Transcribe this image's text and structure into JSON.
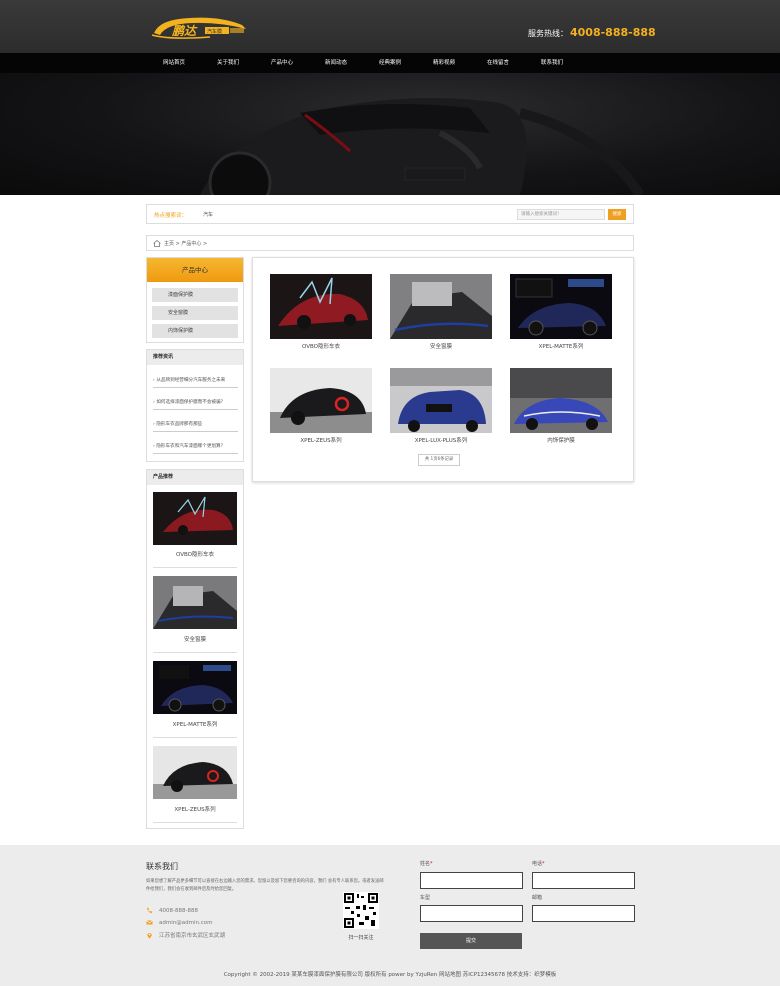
{
  "header": {
    "logo_text": "鹏达",
    "logo_sub": "汽车膜",
    "hotline_label": "服务热线：",
    "hotline_number": "4008-888-888"
  },
  "nav": [
    "网站首页",
    "关于我们",
    "产品中心",
    "新闻动态",
    "经典案例",
    "精彩视频",
    "在线留言",
    "联系我们"
  ],
  "hot": {
    "label": "热点搜索词：",
    "word": "汽车",
    "search_placeholder": "请输入搜索关键词！",
    "search_button": "搜索"
  },
  "breadcrumb": "主页 > 产品中心 >",
  "sidebar": {
    "category_title": "产品中心",
    "categories": [
      "漆面保护膜",
      "安全窗膜",
      "内饰保护膜"
    ],
    "news_title": "推荐资讯",
    "news": [
      "从品牌到经营细分汽车服务之未来",
      "如何选择漆面保护膜而不会被骗？",
      "隐形车衣品牌那有那些",
      "隐形车衣和汽车漆面哪个更划算？"
    ],
    "products_title": "产品推荐",
    "products": [
      "OVBO隐形车衣",
      "安全窗膜",
      "XPEL-MATTE系列",
      "XPEL-ZEUS系列"
    ]
  },
  "products": [
    "OVBO隐形车衣",
    "安全窗膜",
    "XPEL-MATTE系列",
    "XPEL-ZEUS系列",
    "XPEL-LUX-PLUS系列",
    "内饰保护膜"
  ],
  "pagination": "共 1页6条记录",
  "footer": {
    "title": "联系我们",
    "description": "如果您想了解产品更多细节可以直接在右边输入您的需求。您留以及留下您要咨询的内容，我们 会有专人联系您。或者发送邮件给我们，我们会在收到邮件后及时给您回复。",
    "phone": "4008-888-888",
    "email": "admin@admin.com",
    "address": "江苏省南京市玄武区玄武湖",
    "qr_caption": "扫一扫关注",
    "form": {
      "name": "姓名",
      "phone": "电话",
      "car": "车型",
      "email": "邮箱",
      "required_mark": "*",
      "submit": "提交"
    },
    "copyright": "Copyright © 2002-2019 某某车膜漆面保护膜有限公司 版权所有 power by YzjuRen    网站地图    苏ICP12345678    技术支持：织梦模板"
  },
  "colors": {
    "accent": "#f0a020",
    "header_bg": "#333333",
    "nav_bg": "#050505",
    "footer_bg": "#ececec"
  }
}
